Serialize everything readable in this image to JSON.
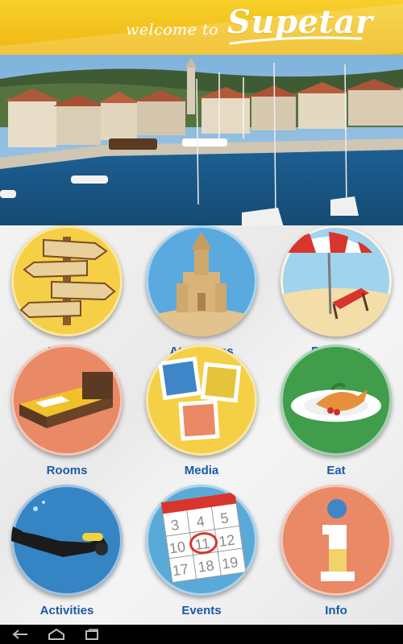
{
  "header": {
    "welcome_text": "welcome to",
    "brand_name": "Supetar",
    "background_color": "#f3c11d"
  },
  "banner": {
    "image": "supetar-harbour-photo"
  },
  "tiles": [
    {
      "label": "Places",
      "icon": "signpost-icon",
      "bg": "#f3c935"
    },
    {
      "label": "Attractions",
      "icon": "sandcastle-church-icon",
      "bg": "#4d9fd9"
    },
    {
      "label": "Beaches",
      "icon": "beach-umbrella-icon",
      "bg": "#f7e7b7"
    },
    {
      "label": "Rooms",
      "icon": "bed-icon",
      "bg": "#e7815f"
    },
    {
      "label": "Media",
      "icon": "photos-icon",
      "bg": "#f3c935"
    },
    {
      "label": "Eat",
      "icon": "fish-plate-icon",
      "bg": "#3d9b49"
    },
    {
      "label": "Activities",
      "icon": "scuba-diver-icon",
      "bg": "#2f79b9"
    },
    {
      "label": "Events",
      "icon": "calendar-icon",
      "bg": "#4a9fd3"
    },
    {
      "label": "Info",
      "icon": "info-icon",
      "bg": "#e7815f"
    }
  ],
  "calendar": {
    "numbers": [
      "3",
      "4",
      "5",
      "10",
      "11",
      "12",
      "17",
      "18",
      "19"
    ]
  },
  "label_color": "#1c5aa6",
  "navbar": {
    "buttons": [
      "back-icon",
      "home-icon",
      "recent-apps-icon"
    ]
  }
}
